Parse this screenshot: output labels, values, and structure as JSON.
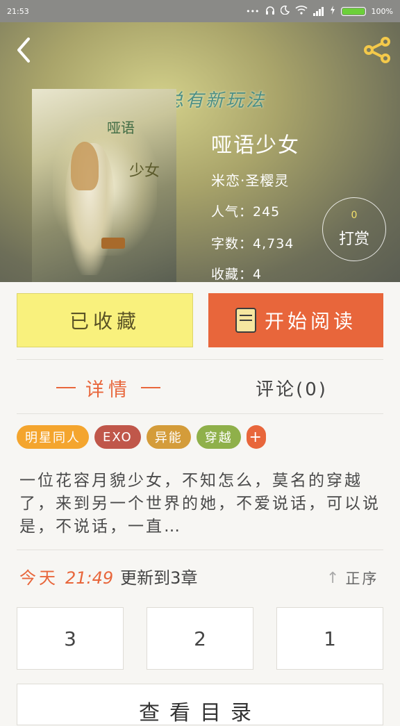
{
  "status_bar": {
    "time": "21:53",
    "battery_text": "100%"
  },
  "header": {
    "banner": "音乐总有新玩法"
  },
  "book": {
    "title": "哑语少女",
    "author": "米恋·圣樱灵",
    "popularity": "人气：245",
    "word_count": "字数：4,734",
    "favorites": "收藏：4",
    "cover_title_a": "哑语",
    "cover_title_b": "少女"
  },
  "tip": {
    "count": "0",
    "label": "打赏"
  },
  "actions": {
    "collected_label": "已收藏",
    "read_label": "开始阅读"
  },
  "tabs": {
    "details": "详情",
    "comments": "评论(0)"
  },
  "tags": [
    {
      "label": "明星同人",
      "color": "#f4a52e"
    },
    {
      "label": "EXO",
      "color": "#c0574a"
    },
    {
      "label": "异能",
      "color": "#d49c3a"
    },
    {
      "label": "穿越",
      "color": "#8fb04a"
    },
    {
      "label": "+",
      "color": "#e8663b"
    }
  ],
  "description": "一位花容月貌少女，不知怎么，莫名的穿越了，来到另一个世界的她，不爱说话，可以说是，不说话，一直…",
  "update": {
    "day": "今天",
    "time": "21:49",
    "text": "更新到3章"
  },
  "sort": {
    "label": "正序"
  },
  "chapters": [
    "3",
    "2",
    "1"
  ],
  "catalog": {
    "label": "查看目录"
  },
  "colors": {
    "accent": "#e8663b",
    "collected_bg": "#f9f17d"
  }
}
